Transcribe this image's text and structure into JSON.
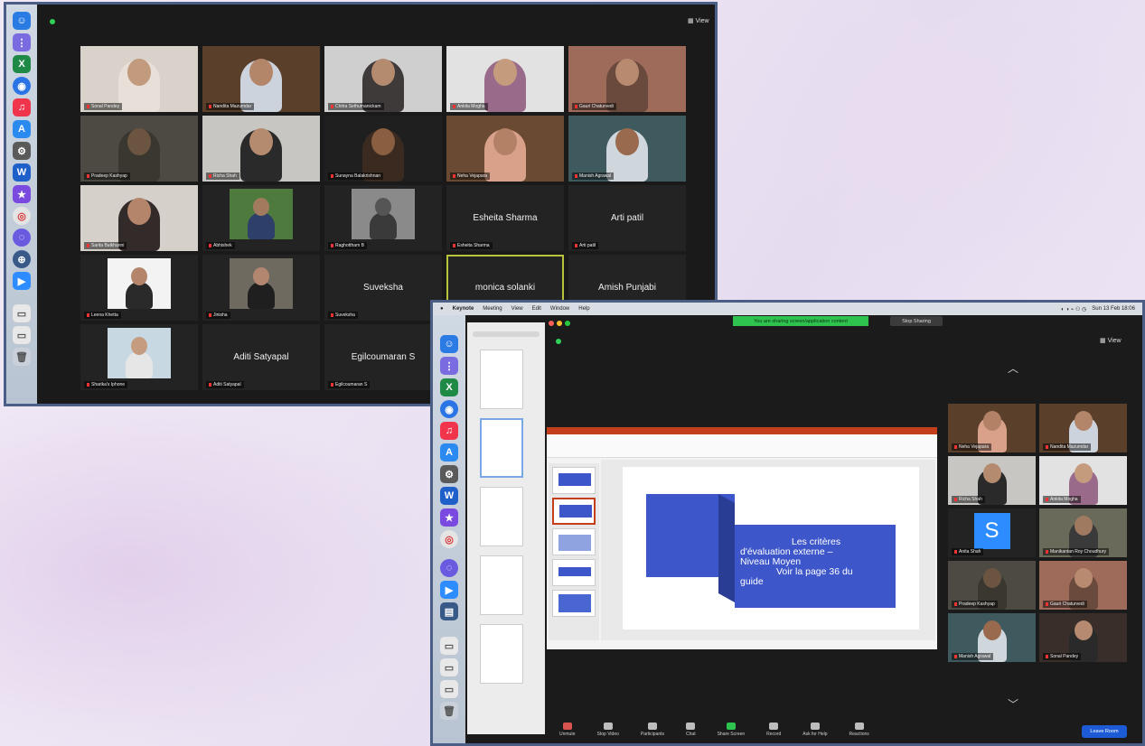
{
  "window1": {
    "view_label": "View",
    "tiles": [
      {
        "name": "Sonal Pandey",
        "type": "video",
        "bg": "#d8d2ca",
        "skin": "#c29a7e",
        "shirt": "#e8e0d8"
      },
      {
        "name": "Nandita Mazumdar",
        "type": "video",
        "bg": "#5a3f2a",
        "skin": "#b3866a",
        "shirt": "#cdd3dc"
      },
      {
        "name": "Chitra Sethumanickam",
        "type": "video",
        "bg": "#cfcfcf",
        "skin": "#b48b6f",
        "shirt": "#3e3a3a"
      },
      {
        "name": "Ankita Mogha",
        "type": "video",
        "bg": "#e2e2e2",
        "skin": "#c59b7e",
        "shirt": "#9a6a8a"
      },
      {
        "name": "Gauri Chaturvedi",
        "type": "video",
        "bg": "#9e6b5a",
        "skin": "#b88a70",
        "shirt": "#6b4a3e"
      },
      {
        "name": "Pradeep Kashyap",
        "type": "video",
        "bg": "#4d4a43",
        "skin": "#6b5540",
        "shirt": "#3a3630"
      },
      {
        "name": "Richa Shah",
        "type": "video",
        "bg": "#c8c6c2",
        "skin": "#b48b6f",
        "shirt": "#2a2a2a"
      },
      {
        "name": "Sunayna Balakrishnan",
        "type": "video",
        "bg": "#1f1f1f",
        "skin": "#8a5e40",
        "shirt": "#3a2a20"
      },
      {
        "name": "Neha Vejapara",
        "type": "video",
        "bg": "#6a4a32",
        "skin": "#b38266",
        "shirt": "#d9a08a"
      },
      {
        "name": "Manish Agrawal",
        "type": "video",
        "bg": "#3e5a5e",
        "skin": "#9a6a4e",
        "shirt": "#cfd6dc"
      },
      {
        "name": "Sarita Balkhanni",
        "type": "video",
        "bg": "#d6d0cb",
        "skin": "#b4856a",
        "shirt": "#332a2a"
      },
      {
        "name": "Abhishek",
        "type": "photo",
        "bg": "#4f7a3e",
        "skin": "#a27a5e",
        "shirt": "#2e3f6a"
      },
      {
        "name": "Raghottham B",
        "type": "photo",
        "bg": "#8a8a8a",
        "skin": "#555555",
        "shirt": "#3a3a3a"
      },
      {
        "name": "Esheita Sharma",
        "type": "name",
        "bigname": "Esheita Sharma"
      },
      {
        "name": "Arti patil",
        "type": "name",
        "bigname": "Arti patil"
      },
      {
        "name": "Leena Khetta",
        "type": "photo",
        "bg": "#f3f3f3",
        "skin": "#b4856a",
        "shirt": "#2a2a2a"
      },
      {
        "name": "Jinisha",
        "type": "photo",
        "bg": "#6f6a5f",
        "skin": "#b38670",
        "shirt": "#1f1f1f"
      },
      {
        "name": "Suveksha",
        "type": "name",
        "bigname": "Suveksha"
      },
      {
        "name": "monica solanki",
        "type": "name",
        "bigname": "monica solanki",
        "active": true
      },
      {
        "name": "Amish Punjabi",
        "type": "name",
        "bigname": "Amish Punjabi"
      },
      {
        "name": "Sharika's Iphone",
        "type": "photo",
        "bg": "#c7d8e2",
        "skin": "#c59c80",
        "shirt": "#e6e6e6"
      },
      {
        "name": "Aditi Satyapal",
        "type": "name",
        "bigname": "Aditi Satyapal"
      },
      {
        "name": "Egilcoumaran S",
        "type": "name",
        "bigname": "Egilcoumaran S"
      }
    ]
  },
  "window2": {
    "menubar": {
      "items": [
        "Keynote",
        "Meeting",
        "View",
        "Edit",
        "Window",
        "Help"
      ],
      "clock": "Sun 13 Feb 18:06"
    },
    "share_banner": "You are sharing screen/application content",
    "stop_share_label": "Stop Sharing",
    "view_label": "View",
    "slide": {
      "line1": "Les critères",
      "line2a": "d'évaluation externe –",
      "line2b": "Niveau Moyen",
      "line3": "Voir la page 36 du",
      "line4": "guide"
    },
    "gallery": [
      {
        "name": "Neha Vejapara",
        "bg": "#5a3f2a",
        "skin": "#b38266",
        "shirt": "#d9a08a",
        "active": true
      },
      {
        "name": "Nandita Mazumdar",
        "bg": "#5a3f2a",
        "skin": "#b3866a",
        "shirt": "#cdd3dc"
      },
      {
        "name": "Richa Shah",
        "bg": "#c8c6c2",
        "skin": "#b48b6f",
        "shirt": "#2a2a2a"
      },
      {
        "name": "Ankita Mogha",
        "bg": "#e2e2e2",
        "skin": "#c59b7e",
        "shirt": "#9a6a8a"
      },
      {
        "name": "Anita Shah",
        "avatar_letter": "S"
      },
      {
        "name": "Manikantan Roy Choudhury",
        "bg": "#6a6a5a",
        "skin": "#a07a60",
        "shirt": "#3a3a3a"
      },
      {
        "name": "Pradeep Kashyap",
        "bg": "#4d4a43",
        "skin": "#6b5540",
        "shirt": "#3a3630"
      },
      {
        "name": "Gauri Chaturvedi",
        "bg": "#9e6b5a",
        "skin": "#b88a70",
        "shirt": "#6b4a3e"
      },
      {
        "name": "Manish Agrawal",
        "bg": "#3e5a5e",
        "skin": "#9a6a4e",
        "shirt": "#cfd6dc"
      },
      {
        "name": "Sonal Pandey",
        "bg": "#3a2e2a",
        "skin": "#b58a70",
        "shirt": "#2a2a2a"
      }
    ],
    "toolbar": [
      "Unmute",
      "Stop Video",
      "Participants",
      "Chat",
      "Share Screen",
      "Record",
      "Ask for Help",
      "Reactions"
    ],
    "leave_label": "Leave Room"
  }
}
